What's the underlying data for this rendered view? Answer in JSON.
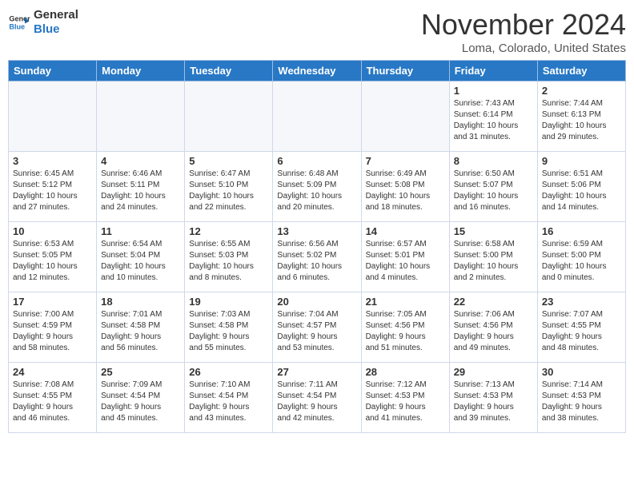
{
  "logo": {
    "line1": "General",
    "line2": "Blue"
  },
  "title": "November 2024",
  "subtitle": "Loma, Colorado, United States",
  "weekdays": [
    "Sunday",
    "Monday",
    "Tuesday",
    "Wednesday",
    "Thursday",
    "Friday",
    "Saturday"
  ],
  "weeks": [
    [
      {
        "day": "",
        "info": ""
      },
      {
        "day": "",
        "info": ""
      },
      {
        "day": "",
        "info": ""
      },
      {
        "day": "",
        "info": ""
      },
      {
        "day": "",
        "info": ""
      },
      {
        "day": "1",
        "info": "Sunrise: 7:43 AM\nSunset: 6:14 PM\nDaylight: 10 hours\nand 31 minutes."
      },
      {
        "day": "2",
        "info": "Sunrise: 7:44 AM\nSunset: 6:13 PM\nDaylight: 10 hours\nand 29 minutes."
      }
    ],
    [
      {
        "day": "3",
        "info": "Sunrise: 6:45 AM\nSunset: 5:12 PM\nDaylight: 10 hours\nand 27 minutes."
      },
      {
        "day": "4",
        "info": "Sunrise: 6:46 AM\nSunset: 5:11 PM\nDaylight: 10 hours\nand 24 minutes."
      },
      {
        "day": "5",
        "info": "Sunrise: 6:47 AM\nSunset: 5:10 PM\nDaylight: 10 hours\nand 22 minutes."
      },
      {
        "day": "6",
        "info": "Sunrise: 6:48 AM\nSunset: 5:09 PM\nDaylight: 10 hours\nand 20 minutes."
      },
      {
        "day": "7",
        "info": "Sunrise: 6:49 AM\nSunset: 5:08 PM\nDaylight: 10 hours\nand 18 minutes."
      },
      {
        "day": "8",
        "info": "Sunrise: 6:50 AM\nSunset: 5:07 PM\nDaylight: 10 hours\nand 16 minutes."
      },
      {
        "day": "9",
        "info": "Sunrise: 6:51 AM\nSunset: 5:06 PM\nDaylight: 10 hours\nand 14 minutes."
      }
    ],
    [
      {
        "day": "10",
        "info": "Sunrise: 6:53 AM\nSunset: 5:05 PM\nDaylight: 10 hours\nand 12 minutes."
      },
      {
        "day": "11",
        "info": "Sunrise: 6:54 AM\nSunset: 5:04 PM\nDaylight: 10 hours\nand 10 minutes."
      },
      {
        "day": "12",
        "info": "Sunrise: 6:55 AM\nSunset: 5:03 PM\nDaylight: 10 hours\nand 8 minutes."
      },
      {
        "day": "13",
        "info": "Sunrise: 6:56 AM\nSunset: 5:02 PM\nDaylight: 10 hours\nand 6 minutes."
      },
      {
        "day": "14",
        "info": "Sunrise: 6:57 AM\nSunset: 5:01 PM\nDaylight: 10 hours\nand 4 minutes."
      },
      {
        "day": "15",
        "info": "Sunrise: 6:58 AM\nSunset: 5:00 PM\nDaylight: 10 hours\nand 2 minutes."
      },
      {
        "day": "16",
        "info": "Sunrise: 6:59 AM\nSunset: 5:00 PM\nDaylight: 10 hours\nand 0 minutes."
      }
    ],
    [
      {
        "day": "17",
        "info": "Sunrise: 7:00 AM\nSunset: 4:59 PM\nDaylight: 9 hours\nand 58 minutes."
      },
      {
        "day": "18",
        "info": "Sunrise: 7:01 AM\nSunset: 4:58 PM\nDaylight: 9 hours\nand 56 minutes."
      },
      {
        "day": "19",
        "info": "Sunrise: 7:03 AM\nSunset: 4:58 PM\nDaylight: 9 hours\nand 55 minutes."
      },
      {
        "day": "20",
        "info": "Sunrise: 7:04 AM\nSunset: 4:57 PM\nDaylight: 9 hours\nand 53 minutes."
      },
      {
        "day": "21",
        "info": "Sunrise: 7:05 AM\nSunset: 4:56 PM\nDaylight: 9 hours\nand 51 minutes."
      },
      {
        "day": "22",
        "info": "Sunrise: 7:06 AM\nSunset: 4:56 PM\nDaylight: 9 hours\nand 49 minutes."
      },
      {
        "day": "23",
        "info": "Sunrise: 7:07 AM\nSunset: 4:55 PM\nDaylight: 9 hours\nand 48 minutes."
      }
    ],
    [
      {
        "day": "24",
        "info": "Sunrise: 7:08 AM\nSunset: 4:55 PM\nDaylight: 9 hours\nand 46 minutes."
      },
      {
        "day": "25",
        "info": "Sunrise: 7:09 AM\nSunset: 4:54 PM\nDaylight: 9 hours\nand 45 minutes."
      },
      {
        "day": "26",
        "info": "Sunrise: 7:10 AM\nSunset: 4:54 PM\nDaylight: 9 hours\nand 43 minutes."
      },
      {
        "day": "27",
        "info": "Sunrise: 7:11 AM\nSunset: 4:54 PM\nDaylight: 9 hours\nand 42 minutes."
      },
      {
        "day": "28",
        "info": "Sunrise: 7:12 AM\nSunset: 4:53 PM\nDaylight: 9 hours\nand 41 minutes."
      },
      {
        "day": "29",
        "info": "Sunrise: 7:13 AM\nSunset: 4:53 PM\nDaylight: 9 hours\nand 39 minutes."
      },
      {
        "day": "30",
        "info": "Sunrise: 7:14 AM\nSunset: 4:53 PM\nDaylight: 9 hours\nand 38 minutes."
      }
    ]
  ]
}
